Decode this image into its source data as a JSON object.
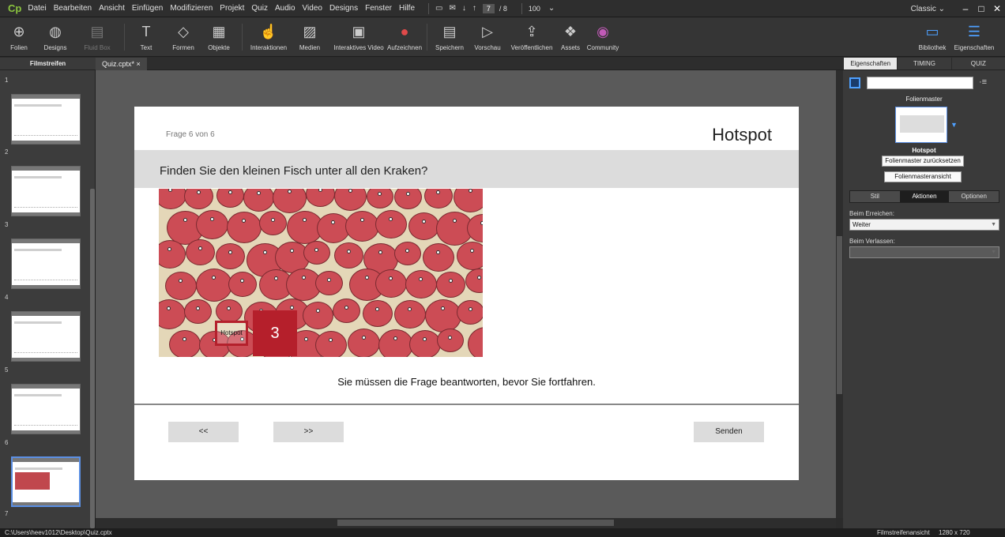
{
  "app": {
    "logo": "Cp",
    "menus": [
      "Datei",
      "Bearbeiten",
      "Ansicht",
      "Einfügen",
      "Modifizieren",
      "Projekt",
      "Quiz",
      "Audio",
      "Video",
      "Designs",
      "Fenster",
      "Hilfe"
    ],
    "page_current": "7",
    "page_total": "/ 8",
    "zoom": "100",
    "workspace": "Classic"
  },
  "toolbar": {
    "tools": [
      {
        "label": "Folien",
        "icon": "add-slide-icon"
      },
      {
        "label": "Designs",
        "icon": "palette-icon"
      },
      {
        "label": "Fluid Box",
        "icon": "fluid-box-icon"
      },
      {
        "label": "Text",
        "icon": "text-icon"
      },
      {
        "label": "Formen",
        "icon": "shapes-icon"
      },
      {
        "label": "Objekte",
        "icon": "objects-icon"
      },
      {
        "label": "Interaktionen",
        "icon": "hand-pointer-icon"
      },
      {
        "label": "Medien",
        "icon": "image-icon"
      },
      {
        "label": "Interaktives Video",
        "icon": "video-icon"
      },
      {
        "label": "Aufzeichnen",
        "icon": "microphone-icon"
      },
      {
        "label": "Speichern",
        "icon": "save-icon"
      },
      {
        "label": "Vorschau",
        "icon": "play-icon"
      },
      {
        "label": "Veröffentlichen",
        "icon": "publish-icon"
      },
      {
        "label": "Assets",
        "icon": "assets-icon"
      },
      {
        "label": "Community",
        "icon": "community-icon"
      }
    ],
    "right_tools": [
      {
        "label": "Bibliothek",
        "icon": "library-icon"
      },
      {
        "label": "Eigenschaften",
        "icon": "properties-icon"
      }
    ]
  },
  "panels": {
    "filmstrip_tab": "Filmstreifen",
    "doc_tab": "Quiz.cptx*",
    "right_tabs": [
      "Eigenschaften",
      "TIMING",
      "QUIZ"
    ]
  },
  "filmstrip": {
    "slides": [
      "1",
      "2",
      "3",
      "4",
      "5",
      "6",
      "7"
    ]
  },
  "slide": {
    "counter": "Frage 6 von 6",
    "title": "Hotspot",
    "question": "Finden Sie den kleinen Fisch unter all den Kraken?",
    "hotspot_label": "Hotspot",
    "badge": "3",
    "message": "Sie müssen die Frage beantworten, bevor Sie fortfahren.",
    "buttons": {
      "back": "<<",
      "next": ">>",
      "submit": "Senden"
    }
  },
  "properties": {
    "master_label": "Folienmaster",
    "master_name": "Hotspot",
    "reset_button": "Folienmaster zurücksetzen",
    "view_button": "Folienmasteransicht",
    "segments": [
      "Stil",
      "Aktionen",
      "Optionen"
    ],
    "on_enter_label": "Beim Erreichen:",
    "on_enter_value": "Weiter",
    "on_exit_label": "Beim Verlassen:",
    "on_exit_value": ""
  },
  "status": {
    "path": "C:\\Users\\heev1012\\Desktop\\Quiz.cptx",
    "view": "Filmstreifenansicht",
    "size": "1280 x 720"
  },
  "colors": {
    "accent": "#5b8fe4",
    "brand": "#8bc53f",
    "hotspot_red": "#b51f2b"
  }
}
